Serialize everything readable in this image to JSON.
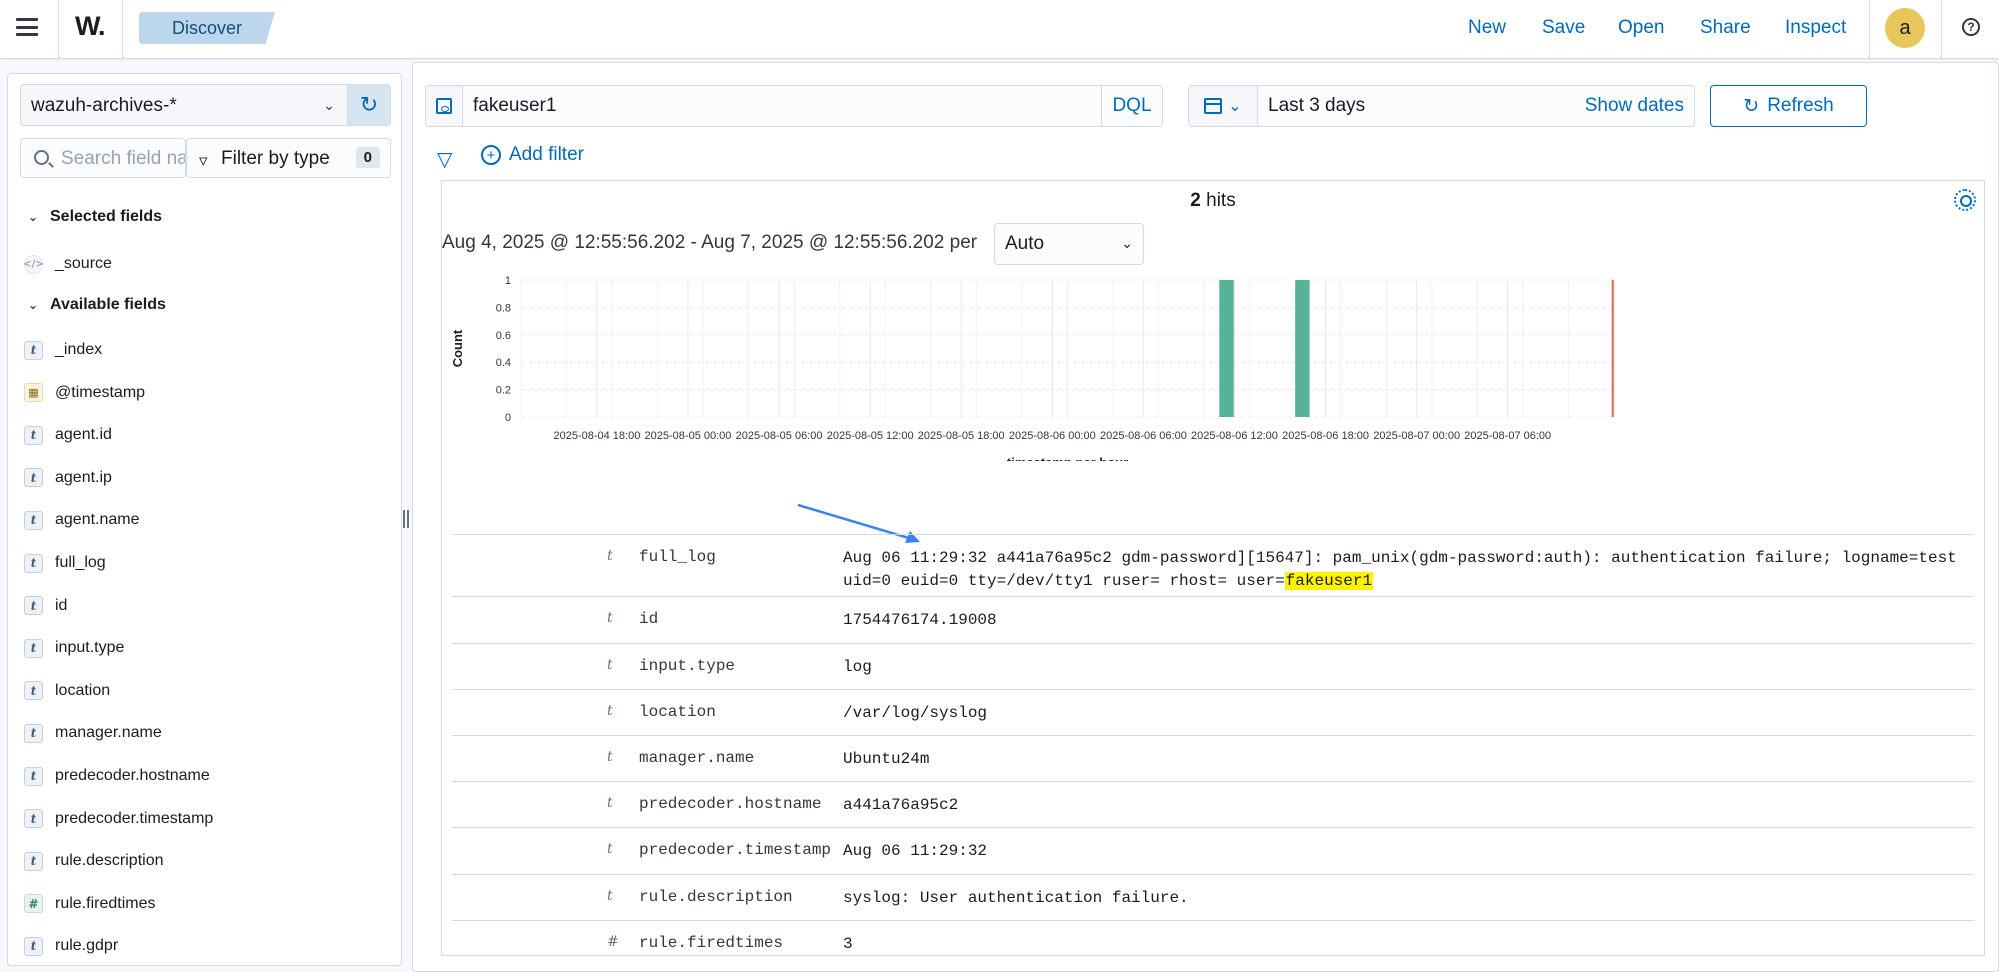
{
  "header": {
    "logo_text": "W.",
    "breadcrumb": "Discover",
    "links": [
      "New",
      "Save",
      "Open",
      "Share",
      "Inspect"
    ],
    "avatar_initial": "a",
    "help_glyph": "?"
  },
  "sidebar": {
    "index_pattern": "wazuh-archives-*",
    "search_placeholder": "Search field names",
    "filter_by_type_label": "Filter by type",
    "filter_count": "0",
    "selected_fields_label": "Selected fields",
    "selected_fields": [
      {
        "name": "_source",
        "type": "source",
        "icon": "</>"
      }
    ],
    "available_fields_label": "Available fields",
    "available_fields": [
      {
        "name": "_index",
        "type": "string",
        "icon": "t"
      },
      {
        "name": "@timestamp",
        "type": "date",
        "icon": "▦"
      },
      {
        "name": "agent.id",
        "type": "string",
        "icon": "t"
      },
      {
        "name": "agent.ip",
        "type": "string",
        "icon": "t"
      },
      {
        "name": "agent.name",
        "type": "string",
        "icon": "t"
      },
      {
        "name": "full_log",
        "type": "string",
        "icon": "t"
      },
      {
        "name": "id",
        "type": "string",
        "icon": "t"
      },
      {
        "name": "input.type",
        "type": "string",
        "icon": "t"
      },
      {
        "name": "location",
        "type": "string",
        "icon": "t"
      },
      {
        "name": "manager.name",
        "type": "string",
        "icon": "t"
      },
      {
        "name": "predecoder.hostname",
        "type": "string",
        "icon": "t"
      },
      {
        "name": "predecoder.timestamp",
        "type": "string",
        "icon": "t"
      },
      {
        "name": "rule.description",
        "type": "string",
        "icon": "t"
      },
      {
        "name": "rule.firedtimes",
        "type": "number",
        "icon": "#"
      },
      {
        "name": "rule.gdpr",
        "type": "string",
        "icon": "t"
      }
    ]
  },
  "query": {
    "value": "fakeuser1",
    "language": "DQL",
    "time_range": "Last 3 days",
    "show_dates": "Show dates",
    "refresh_label": "Refresh",
    "add_filter_label": "Add filter"
  },
  "results": {
    "hits_count": "2",
    "hits_label": "hits",
    "date_range_text": "Aug 4, 2025 @ 12:55:56.202 - Aug 7, 2025 @ 12:55:56.202 per",
    "interval": "Auto"
  },
  "chart_data": {
    "type": "bar",
    "xlabel": "timestamp per hour",
    "ylabel": "Count",
    "ylim": [
      0,
      1
    ],
    "y_ticks": [
      "0",
      "0.2",
      "0.4",
      "0.6",
      "0.8",
      "1"
    ],
    "x_ticks": [
      "2025-08-04 18:00",
      "2025-08-05 00:00",
      "2025-08-05 06:00",
      "2025-08-05 12:00",
      "2025-08-05 18:00",
      "2025-08-06 00:00",
      "2025-08-06 06:00",
      "2025-08-06 12:00",
      "2025-08-06 18:00",
      "2025-08-07 00:00",
      "2025-08-07 06:00"
    ],
    "x_start": "2025-08-04 13:00",
    "x_end": "2025-08-07 13:00",
    "bars": [
      {
        "x": "2025-08-06 11:00",
        "value": 1
      },
      {
        "x": "2025-08-06 16:00",
        "value": 1
      }
    ],
    "bar_color": "#54b399",
    "now_marker": "2025-08-07 12:55",
    "now_color": "#e7664c",
    "grid": true
  },
  "document": {
    "rows": [
      {
        "type_icon": "t",
        "field": "full_log",
        "value": "Aug 06 11:29:32 a441a76a95c2 gdm-password][15647]: pam_unix(gdm-password:auth): authentication failure; logname=test uid=0 euid=0 tty=/dev/tty1 ruser= rhost= user=",
        "highlight": "fakeuser1"
      },
      {
        "type_icon": "t",
        "field": "id",
        "value": "1754476174.19008"
      },
      {
        "type_icon": "t",
        "field": "input.type",
        "value": "log"
      },
      {
        "type_icon": "t",
        "field": "location",
        "value": "/var/log/syslog"
      },
      {
        "type_icon": "t",
        "field": "manager.name",
        "value": "Ubuntu24m"
      },
      {
        "type_icon": "t",
        "field": "predecoder.hostname",
        "value": "a441a76a95c2"
      },
      {
        "type_icon": "t",
        "field": "predecoder.timestamp",
        "value": "Aug 06 11:29:32"
      },
      {
        "type_icon": "t",
        "field": "rule.description",
        "value": "syslog: User authentication failure."
      },
      {
        "type_icon": "#",
        "field": "rule.firedtimes",
        "value": "3"
      }
    ]
  },
  "colors": {
    "accent": "#006bb8",
    "bar": "#54b399",
    "now_line": "#e7664c",
    "highlight": "#fff200",
    "annotation_arrow": "#3b82f6"
  }
}
